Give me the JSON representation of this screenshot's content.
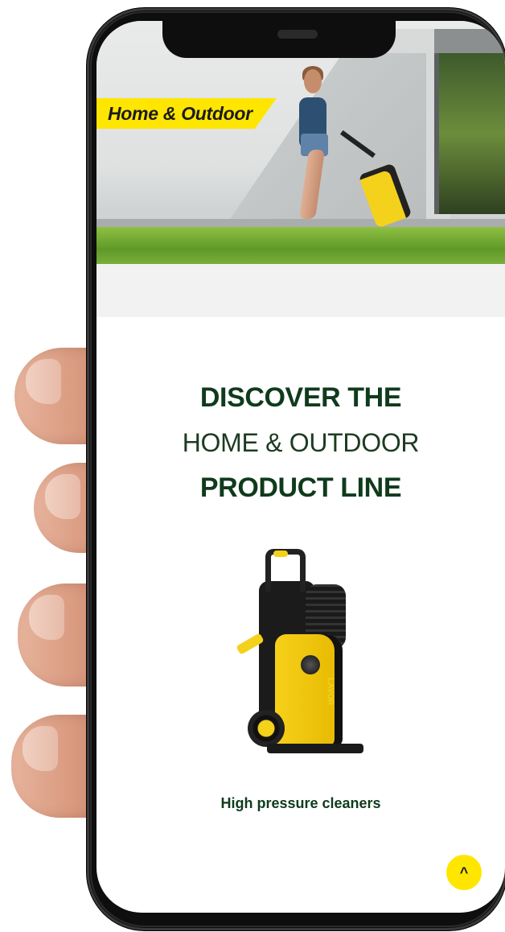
{
  "hero": {
    "tag": "Home & Outdoor"
  },
  "headline": {
    "line1": "DISCOVER THE",
    "line2": "HOME & OUTDOOR",
    "line3": "PRODUCT LINE"
  },
  "product": {
    "label": "High pressure cleaners",
    "brand": "LAVOR",
    "image_icon": "pressure-washer-image"
  },
  "scroll_top": {
    "icon": "chevron-up-icon",
    "glyph": "^"
  },
  "colors": {
    "accent_yellow": "#ffe600",
    "heading_green": "#0f3b1c",
    "phone_body": "#0e0e0e"
  }
}
